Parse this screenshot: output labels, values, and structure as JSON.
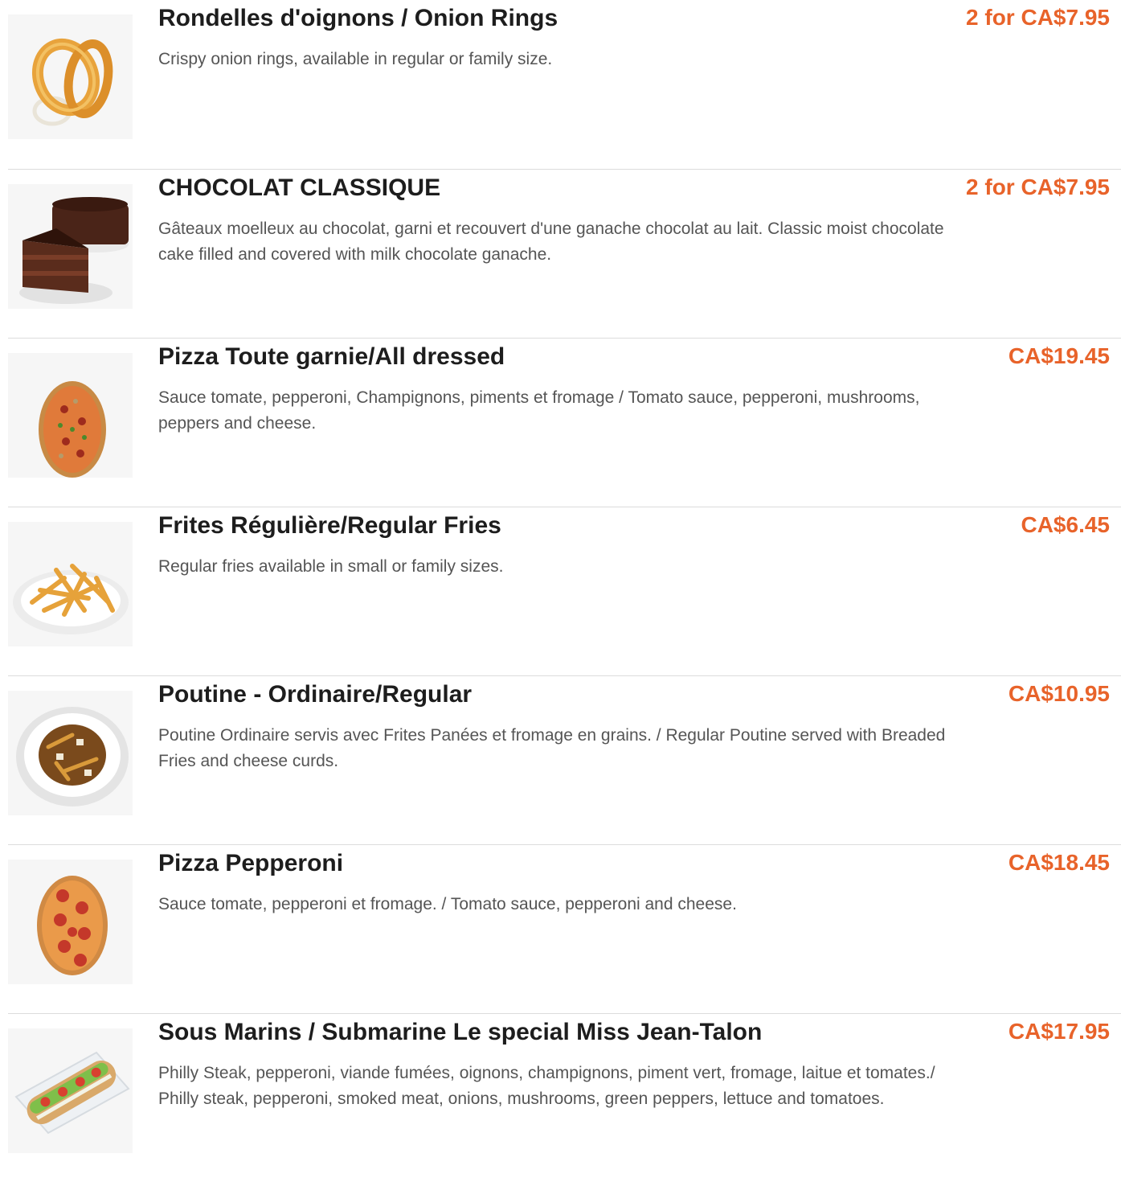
{
  "accent_color": "#e8632a",
  "items": [
    {
      "name": "Rondelles d'oignons / Onion Rings",
      "price": "2 for CA$7.95",
      "description": "Crispy onion rings, available in regular or family size.",
      "image_icon": "onion-rings-image"
    },
    {
      "name": "CHOCOLAT CLASSIQUE",
      "price": "2 for CA$7.95",
      "description": "Gâteaux moelleux au chocolat, garni et recouvert d'une ganache chocolat au lait. Classic moist chocolate cake filled and covered with milk chocolate ganache.",
      "image_icon": "chocolate-cake-image"
    },
    {
      "name": "Pizza Toute garnie/All dressed",
      "price": "CA$19.45",
      "description": "Sauce tomate, pepperoni, Champignons, piments et fromage / Tomato sauce, pepperoni, mushrooms, peppers and cheese.",
      "image_icon": "all-dressed-pizza-image"
    },
    {
      "name": "Frites Régulière/Regular Fries",
      "price": "CA$6.45",
      "description": "Regular fries available in small or family sizes.",
      "image_icon": "fries-image"
    },
    {
      "name": "Poutine - Ordinaire/Regular",
      "price": "CA$10.95",
      "description": "Poutine Ordinaire servis avec Frites Panées et fromage en grains. / Regular Poutine served with Breaded Fries and cheese curds.",
      "image_icon": "poutine-image"
    },
    {
      "name": "Pizza Pepperoni",
      "price": "CA$18.45",
      "description": "Sauce tomate, pepperoni et fromage. / Tomato sauce, pepperoni and cheese.",
      "image_icon": "pepperoni-pizza-image"
    },
    {
      "name": "Sous Marins / Submarine Le special Miss Jean-Talon",
      "price": "CA$17.95",
      "description": "Philly Steak, pepperoni, viande fumées, oignons, champignons, piment vert, fromage, laitue et tomates./ Philly steak, pepperoni, smoked meat, onions, mushrooms, green peppers, lettuce and tomatoes.",
      "image_icon": "submarine-sandwich-image"
    }
  ]
}
